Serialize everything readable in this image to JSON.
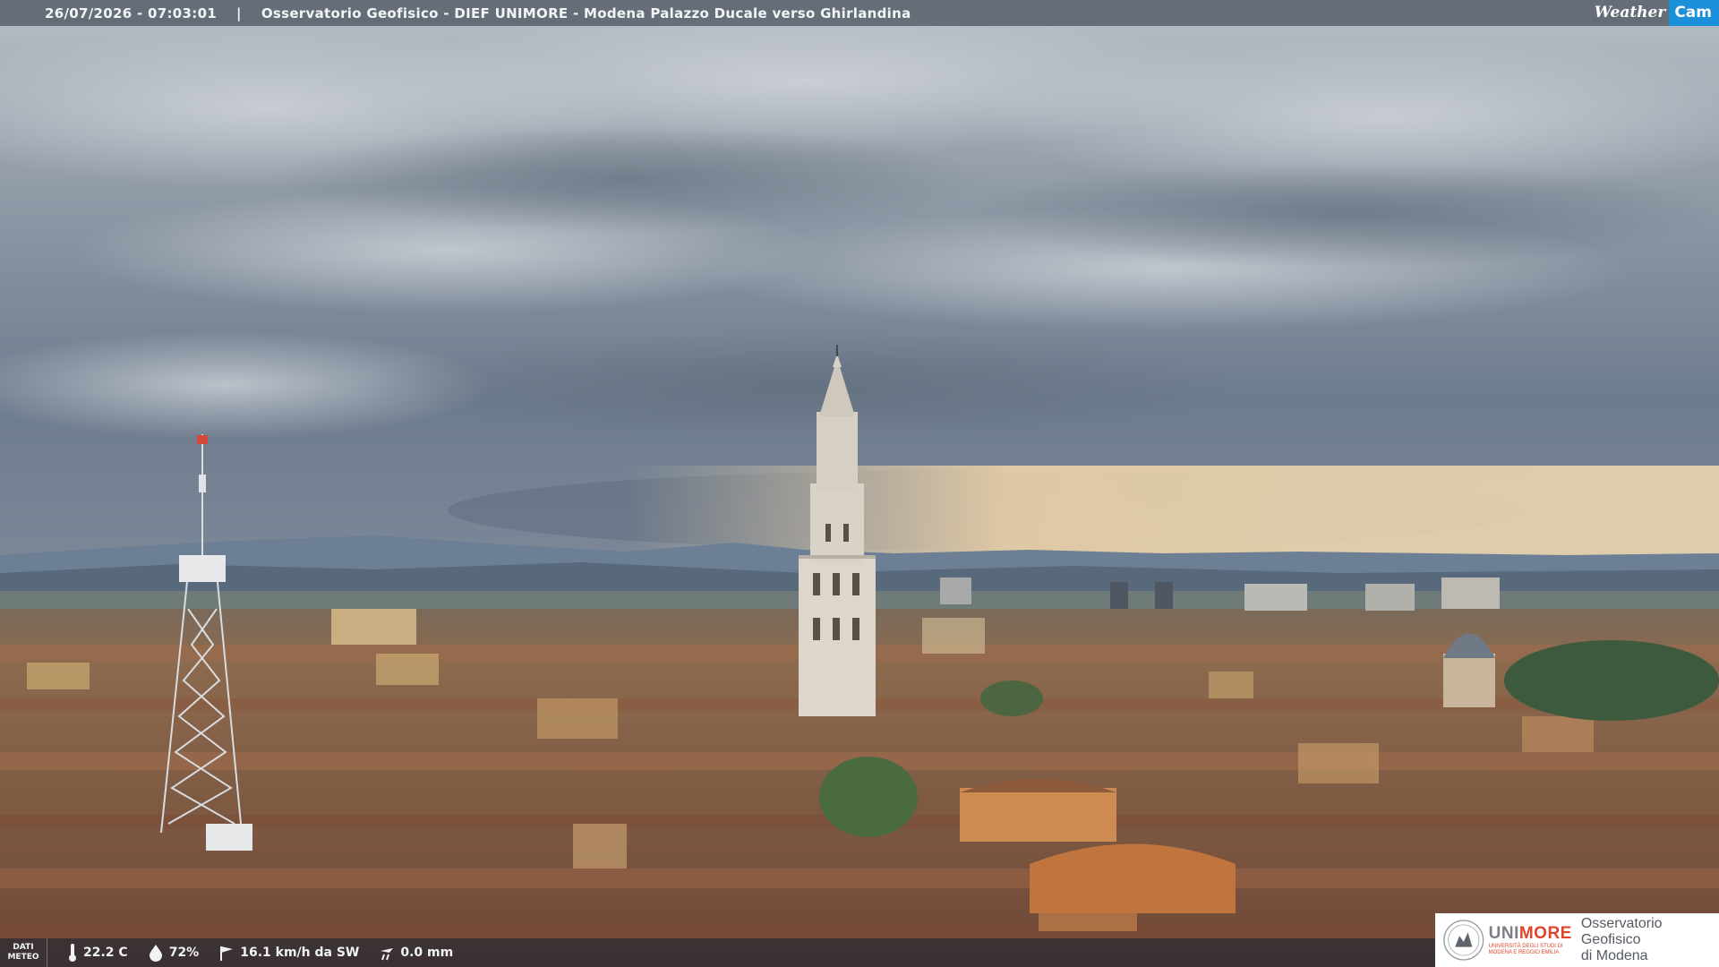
{
  "header": {
    "datetime": "26/07/2026 - 07:03:01",
    "separator": "|",
    "location": "Osservatorio Geofisico - DIEF UNIMORE - Modena Palazzo Ducale verso Ghirlandina"
  },
  "brand": {
    "part1": "Weather",
    "part2": "Cam",
    "accent_color": "#1b8fd8"
  },
  "meteo": {
    "tag_line1": "DATI",
    "tag_line2": "METEO",
    "temperature": "22.2 C",
    "humidity": "72%",
    "wind": "16.1 km/h da SW",
    "rain": "0.0 mm",
    "icons": [
      "thermometer-icon",
      "humidity-drop-icon",
      "wind-icon",
      "rain-gauge-icon"
    ]
  },
  "logo": {
    "name_part1": "UNI",
    "name_part2": "MORE",
    "sub_line1": "UNIVERSITÀ DEGLI STUDI DI",
    "sub_line2": "MODENA E REGGIO EMILIA",
    "right_line1": "Osservatorio Geofisico",
    "right_line2": "di Modena",
    "accent_color": "#e0452c"
  },
  "scene": {
    "description_icon": "webcam-cityscape-photo",
    "sky_color": "#8d97a3",
    "roof_color": "#8a5a40"
  }
}
